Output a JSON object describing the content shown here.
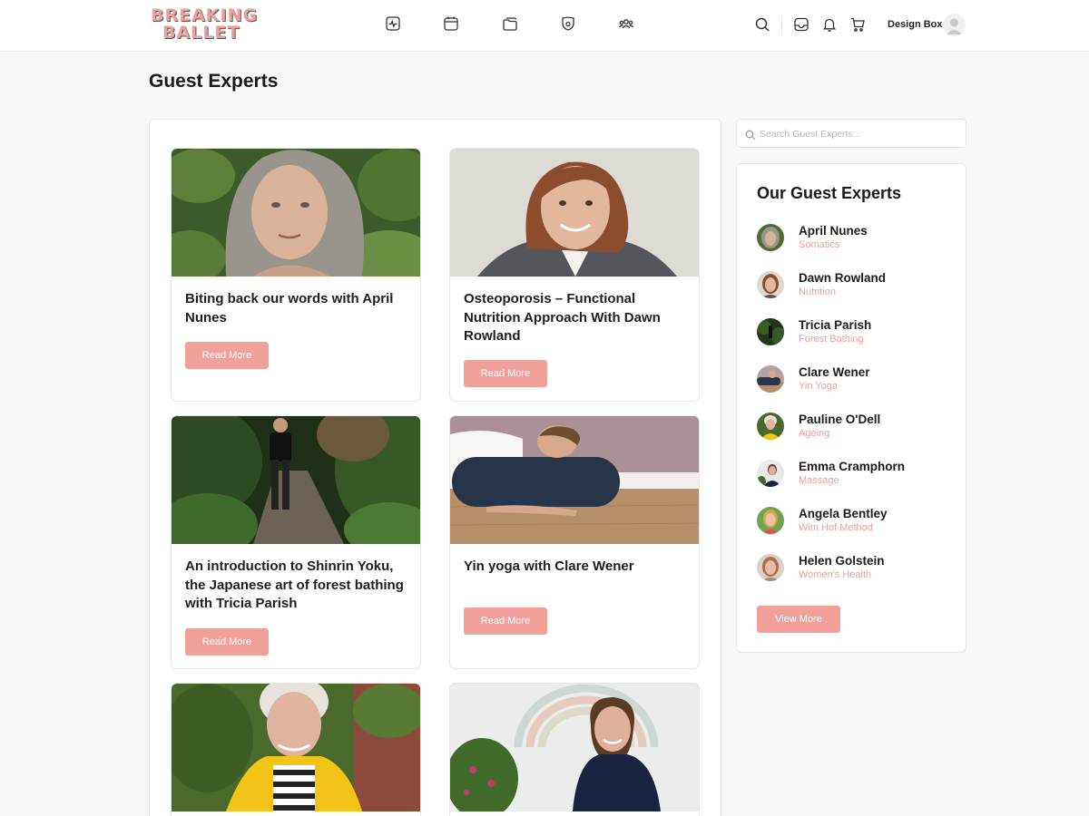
{
  "header": {
    "logo_line1": "BREAKING",
    "logo_line2": "BALLET",
    "nav_icons": [
      "activity-icon",
      "calendar-icon",
      "folder-icon",
      "badge-icon",
      "community-icon"
    ],
    "user_name": "Design Box"
  },
  "page": {
    "title": "Guest Experts"
  },
  "cards": [
    {
      "title": "Biting back our words with April Nunes",
      "button": "Read More",
      "image": "april-nunes-portrait"
    },
    {
      "title": "Osteoporosis – Functional Nutrition Approach With Dawn Rowland",
      "button": "Read More",
      "image": "dawn-rowland-portrait"
    },
    {
      "title": "An introduction to Shinrin Yoku, the Japanese art of forest bathing with Tricia Parish",
      "button": "Read More",
      "image": "forest-path-photo"
    },
    {
      "title": "Yin yoga with Clare Wener",
      "button": "Read More",
      "image": "yin-yoga-bolster-photo"
    },
    {
      "title": "",
      "button": "",
      "image": "yellow-raincoat-portrait"
    },
    {
      "title": "",
      "button": "",
      "image": "rainbow-wall-portrait"
    }
  ],
  "sidebar": {
    "search_placeholder": "Search Guest Experts...",
    "title": "Our Guest Experts",
    "experts": [
      {
        "name": "April Nunes",
        "specialty": "Somatics"
      },
      {
        "name": "Dawn Rowland",
        "specialty": "Nutrition"
      },
      {
        "name": "Tricia Parish",
        "specialty": "Forest Bathing"
      },
      {
        "name": "Clare Wener",
        "specialty": "Yin Yoga"
      },
      {
        "name": "Pauline O'Dell",
        "specialty": "Ageing"
      },
      {
        "name": "Emma Cramphorn",
        "specialty": "Massage"
      },
      {
        "name": "Angela Bentley",
        "specialty": "Wim Hof Method"
      },
      {
        "name": "Helen Golstein",
        "specialty": "Women's Health"
      }
    ],
    "view_more": "View More"
  },
  "colors": {
    "accent": "#f1a19a",
    "accent_text": "#ec9f97",
    "background": "#f7f7f5"
  }
}
